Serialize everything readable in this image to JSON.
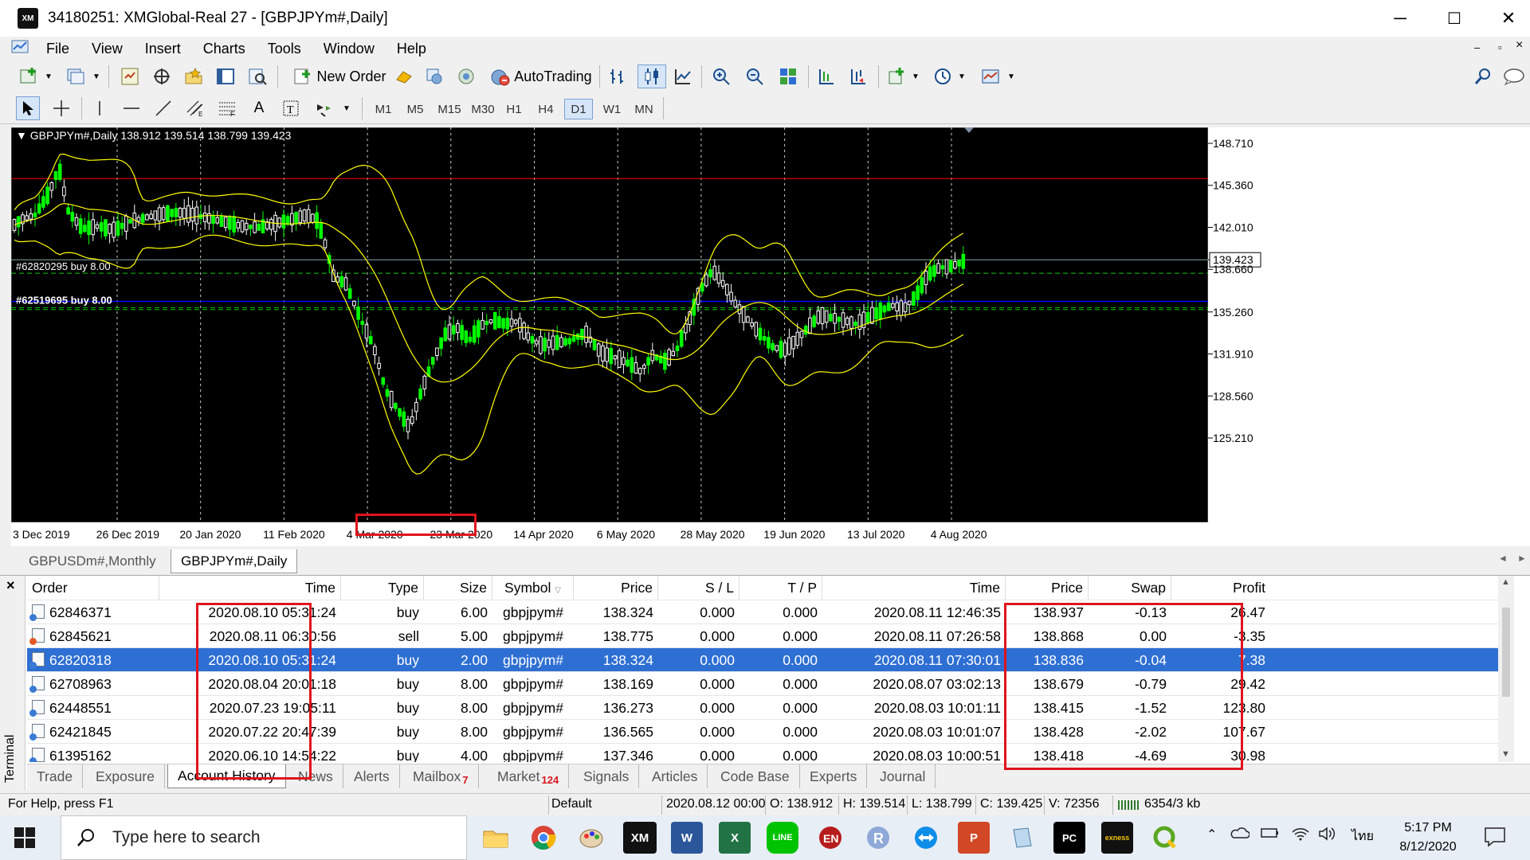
{
  "window": {
    "title": "34180251: XMGlobal-Real 27 - [GBPJPYm#,Daily]",
    "logo": "XM",
    "minimize": "─",
    "maximize": "☐",
    "close": "✕"
  },
  "menu": [
    "File",
    "View",
    "Insert",
    "Charts",
    "Tools",
    "Window",
    "Help"
  ],
  "toolbar": {
    "new_order": "New Order",
    "autotrading": "AutoTrading"
  },
  "timeframes": [
    "M1",
    "M5",
    "M15",
    "M30",
    "H1",
    "H4",
    "D1",
    "W1",
    "MN"
  ],
  "active_timeframe": "D1",
  "chart": {
    "header": "GBPJPYm#,Daily  138.912 139.514 138.799 139.423",
    "price_labels": [
      "148.710",
      "145.360",
      "142.010",
      "139.423",
      "138.660",
      "135.260",
      "131.910",
      "128.560",
      "125.210"
    ],
    "date_labels": [
      "3 Dec 2019",
      "26 Dec 2019",
      "20 Jan 2020",
      "11 Feb 2020",
      "4 Mar 2020",
      "23 Mar 2020",
      "14 Apr 2020",
      "6 May 2020",
      "28 May 2020",
      "19 Jun 2020",
      "13 Jul 2020",
      "4 Aug 2020"
    ],
    "order_label_1": "#62820295 buy 8.00",
    "order_label_2": "#62519695 buy 8.00",
    "current_price": "139.423",
    "colors": {
      "background": "#000000",
      "candle_up": "#ffffff",
      "candle_down": "#00ff00",
      "bands": "#ffff00",
      "resistance_line": "#ff0000",
      "support_line": "#0000ff",
      "order_lines": "#00cc00"
    }
  },
  "chart_tabs": [
    "GBPUSDm#,Monthly",
    "GBPJPYm#,Daily"
  ],
  "active_chart_tab": "GBPJPYm#,Daily",
  "terminal": {
    "label": "Terminal",
    "close": "×",
    "headers": [
      "Order",
      "Time",
      "Type",
      "Size",
      "Symbol",
      "Price",
      "S / L",
      "T / P",
      "Time",
      "Price",
      "Swap",
      "Profit"
    ],
    "rows": [
      {
        "order": "62846371",
        "open_time": "2020.08.10 05:31:24",
        "type": "buy",
        "size": "6.00",
        "symbol": "gbpjpym#",
        "open_price": "138.324",
        "sl": "0.000",
        "tp": "0.000",
        "close_time": "2020.08.11 12:46:35",
        "close_price": "138.937",
        "swap": "-0.13",
        "profit": "26.47"
      },
      {
        "order": "62845621",
        "open_time": "2020.08.11 06:30:56",
        "type": "sell",
        "size": "5.00",
        "symbol": "gbpjpym#",
        "open_price": "138.775",
        "sl": "0.000",
        "tp": "0.000",
        "close_time": "2020.08.11 07:26:58",
        "close_price": "138.868",
        "swap": "0.00",
        "profit": "-3.35"
      },
      {
        "order": "62820318",
        "open_time": "2020.08.10 05:31:24",
        "type": "buy",
        "size": "2.00",
        "symbol": "gbpjpym#",
        "open_price": "138.324",
        "sl": "0.000",
        "tp": "0.000",
        "close_time": "2020.08.11 07:30:01",
        "close_price": "138.836",
        "swap": "-0.04",
        "profit": "7.38"
      },
      {
        "order": "62708963",
        "open_time": "2020.08.04 20:01:18",
        "type": "buy",
        "size": "8.00",
        "symbol": "gbpjpym#",
        "open_price": "138.169",
        "sl": "0.000",
        "tp": "0.000",
        "close_time": "2020.08.07 03:02:13",
        "close_price": "138.679",
        "swap": "-0.79",
        "profit": "29.42"
      },
      {
        "order": "62448551",
        "open_time": "2020.07.23 19:05:11",
        "type": "buy",
        "size": "8.00",
        "symbol": "gbpjpym#",
        "open_price": "136.273",
        "sl": "0.000",
        "tp": "0.000",
        "close_time": "2020.08.03 10:01:11",
        "close_price": "138.415",
        "swap": "-1.52",
        "profit": "123.80"
      },
      {
        "order": "62421845",
        "open_time": "2020.07.22 20:47:39",
        "type": "buy",
        "size": "8.00",
        "symbol": "gbpjpym#",
        "open_price": "136.565",
        "sl": "0.000",
        "tp": "0.000",
        "close_time": "2020.08.03 10:01:07",
        "close_price": "138.428",
        "swap": "-2.02",
        "profit": "107.67"
      },
      {
        "order": "61395162",
        "open_time": "2020.06.10 14:54:22",
        "type": "buy",
        "size": "4.00",
        "symbol": "gbpjpym#",
        "open_price": "137.346",
        "sl": "0.000",
        "tp": "0.000",
        "close_time": "2020.08.03 10:00:51",
        "close_price": "138.418",
        "swap": "-4.69",
        "profit": "30.98"
      }
    ],
    "selected_row": 2,
    "tabs": [
      {
        "label": "Trade",
        "badge": ""
      },
      {
        "label": "Exposure",
        "badge": ""
      },
      {
        "label": "Account History",
        "badge": ""
      },
      {
        "label": "News",
        "badge": ""
      },
      {
        "label": "Alerts",
        "badge": ""
      },
      {
        "label": "Mailbox",
        "badge": "7"
      },
      {
        "label": "Market",
        "badge": "124"
      },
      {
        "label": "Signals",
        "badge": ""
      },
      {
        "label": "Articles",
        "badge": ""
      },
      {
        "label": "Code Base",
        "badge": ""
      },
      {
        "label": "Experts",
        "badge": ""
      },
      {
        "label": "Journal",
        "badge": ""
      }
    ],
    "active_tab": "Account History"
  },
  "statusbar": {
    "help": "For Help, press F1",
    "profile": "Default",
    "datetime": "2020.08.12 00:00",
    "open": "O: 138.912",
    "high": "H: 139.514",
    "low": "L: 138.799",
    "close": "C: 139.425",
    "volume": "V: 72356",
    "traffic": "6354/3 kb"
  },
  "taskbar": {
    "search_placeholder": "Type here to search",
    "time": "5:17 PM",
    "date": "8/12/2020",
    "language": "ไทย",
    "apps": [
      "file-explorer",
      "chrome",
      "paint",
      "xm",
      "word",
      "excel",
      "line",
      "dragon",
      "r",
      "teamviewer",
      "powerpoint",
      "notepad",
      "pycharm",
      "exness",
      "qgis"
    ]
  }
}
